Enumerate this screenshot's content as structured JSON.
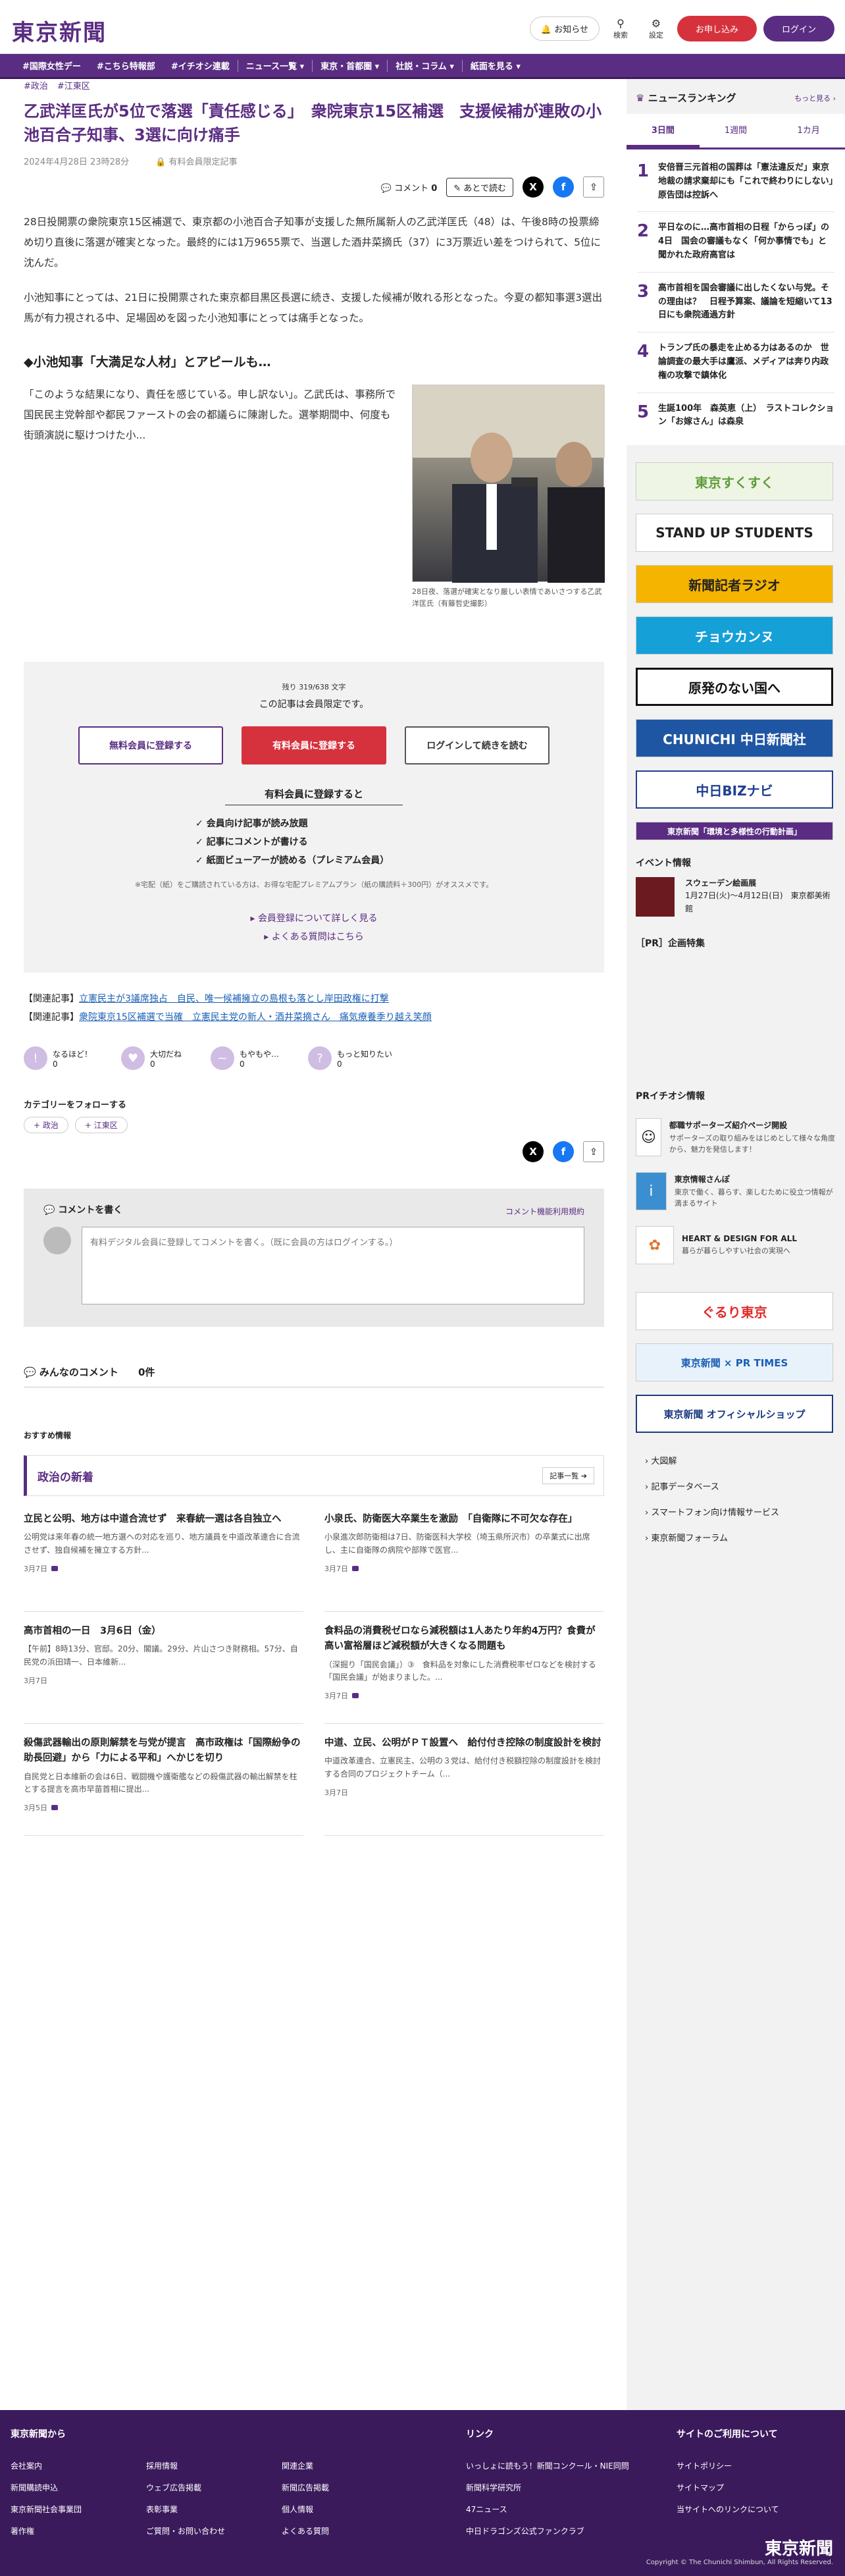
{
  "header": {
    "logo": "東京新聞",
    "notice_label": "お知らせ",
    "search_label": "検索",
    "settings_label": "設定",
    "signup_label": "お申し込み",
    "login_label": "ログイン"
  },
  "nav": [
    "#国際女性デー",
    "#こちら特報部",
    "#イチオシ連載",
    "ニュース一覧 ▾",
    "東京・首都圏 ▾",
    "社説・コラム ▾",
    "紙面を見る ▾"
  ],
  "article": {
    "tags": [
      "#政治",
      "#江東区"
    ],
    "title": "乙武洋匡氏が5位で落選「責任感じる」　衆院東京15区補選　支援候補が連敗の小池百合子知事、3選に向け痛手",
    "date": "2024年4月28日 23時28分",
    "members_only": "有料会員限定記事",
    "comment_label": "コメント",
    "comment_count": "0",
    "read_later": "あとで読む",
    "p1": "28日投開票の衆院東京15区補選で、東京都の小池百合子知事が支援した無所属新人の乙武洋匡氏（48）は、午後8時の投票締め切り直後に落選が確実となった。最終的には1万9655票で、当選した酒井菜摘氏（37）に3万票近い差をつけられて、5位に沈んだ。",
    "p2": "小池知事にとっては、21日に投開票された東京都目黒区長選に続き、支援した候補が敗れる形となった。今夏の都知事選3選出馬が有力視される中、足場固めを図った小池知事にとっては痛手となった。",
    "sub": "◆小池知事「大満足な人材」とアピールも…",
    "p3": "「このような結果になり、責任を感じている。申し訳ない」。乙武氏は、事務所で国民民主党幹部や都民ファーストの会の都議らに陳謝した。選挙期間中、何度も街頭演説に駆けつけた小...",
    "photo_caption": "28日夜、落選が確実となり厳しい表情であいさつする乙武洋匡氏（有籐哲史撮影）"
  },
  "paywall": {
    "remaining": "残り 319/638 文字",
    "limited": "この記事は会員限定です。",
    "free_btn": "無料会員に登録する",
    "paid_btn": "有料会員に登録する",
    "login_btn": "ログインして続きを読む",
    "benefits_title": "有料会員に登録すると",
    "benefits": [
      "会員向け記事が読み放題",
      "記事にコメントが書ける",
      "紙面ビューアーが読める（プレミアム会員）"
    ],
    "note": "※宅配（紙）をご購読されている方は、お得な宅配プレミアムプラン（紙の購読料＋300円）がオススメです。",
    "link1": "会員登録について詳しく見る",
    "link2": "よくある質問はこちら"
  },
  "related": [
    {
      "label": "【関連記事】",
      "text": "立憲民主が3議席独占　自民、唯一候補擁立の島根も落とし岸田政権に打撃"
    },
    {
      "label": "【関連記事】",
      "text": "衆院東京15区補選で当確　立憲民主党の新人・酒井菜摘さん　痛気療養季り越え笑顔"
    }
  ],
  "reactions": [
    {
      "label": "なるほど！",
      "count": "0",
      "icon": "!"
    },
    {
      "label": "大切だね",
      "count": "0",
      "icon": "♥"
    },
    {
      "label": "もやもや…",
      "count": "0",
      "icon": "~"
    },
    {
      "label": "もっと知りたい",
      "count": "0",
      "icon": "?"
    }
  ],
  "follow": {
    "title": "カテゴリーをフォローする",
    "chips": [
      "政治",
      "江東区"
    ]
  },
  "comment_box": {
    "title": "コメントを書く",
    "rules": "コメント機能利用規約",
    "placeholder": "有料デジタル会員に登録してコメントを書く。（既に会員の方はログインする。）"
  },
  "all_comments": {
    "title": "みんなのコメント",
    "count": "0件"
  },
  "recommend": "おすすめ情報",
  "latest": {
    "title": "政治の新着",
    "more": "記事一覧 ➔",
    "cards": [
      {
        "title": "立民と公明、地方は中道合流せず　来春統一選は各自独立へ",
        "summary": "公明党は来年春の統一地方選への対応を巡り、地方議員を中道改革連合に合流させず、独自候補を擁立する方針...",
        "date": "3月7日"
      },
      {
        "title": "小泉氏、防衛医大卒業生を激励　「自衛隊に不可欠な存在」",
        "summary": "小泉進次郎防衛相は7日、防衛医科大学校（埼玉県所沢市）の卒業式に出席し、主に自衛隊の病院や部隊で医官...",
        "date": "3月7日"
      },
      {
        "title": "高市首相の一日　3月6日（金）",
        "summary": "【午前】8時13分、官邸。20分、閣議。29分、片山さつき財務相。57分、自民党の浜田靖一、日本維新...",
        "date": "3月7日"
      },
      {
        "title": "食料品の消費税ゼロなら減税額は1人あたり年約4万円？食費が高い富裕層ほど減税額が大きくなる問題も",
        "summary": "（深掘り「国民会議」）③　食料品を対象にした消費税率ゼロなどを検討する「国民会議」が始まりました。...",
        "date": "3月7日"
      },
      {
        "title": "殺傷武器輸出の原則解禁を与党が提言　高市政権は「国際紛争の助長回避」から「力による平和」へかじを切り",
        "summary": "自民党と日本維新の会は6日、戦闘機や護衛艦などの殺傷武器の輸出解禁を柱とする提言を高市早苗首相に提出...",
        "date": "3月5日"
      },
      {
        "title": "中道、立民、公明がＰＴ設置へ　給付付き控除の制度設計を検討",
        "summary": "中道改革連合、立憲民主、公明の３党は、給付付き税額控除の制度設計を検討する合同のプロジェクトチーム（...",
        "date": "3月7日"
      }
    ]
  },
  "ranking": {
    "title": "ニュースランキング",
    "more": "もっと見る ›",
    "tabs": [
      "3日間",
      "1週間",
      "1カ月"
    ],
    "items": [
      "安倍晋三元首相の国葬は「憲法違反だ」東京地裁の請求棄却にも「これで終わりにしない」原告団は控訴へ",
      "平日なのに…高市首相の日程「からっぽ」の4日　国会の審議もなく「何か事情でも」と聞かれた政府高官は",
      "高市首相を国会審議に出したくない与党。その理由は？　日程予算案、議論を短縮いて13日にも衆院通過方針",
      "トランプ氏の暴走を止める力はあるのか　世論調査の最大手は鷹派、メディアは奔り内政権の攻撃で鎮体化",
      "生誕100年　森英恵（上）　ラストコレクション「お嫁さん」は森泉"
    ]
  },
  "banners": [
    "東京すくすく",
    "STAND UP STUDENTS",
    "新聞記者ラジオ",
    "チョウカンヌ",
    "原発のない国へ",
    "CHUNICHI 中日新聞社",
    "中日BIZナビ",
    "東京新聞「環境と多様性の行動計画」"
  ],
  "event": {
    "title": "イベント情報",
    "name": "スウェーデン絵画展",
    "desc": "1月27日(火)～4月12日(日)　東京都美術館"
  },
  "pr_feature": "［PR］企画特集",
  "pr_pick": {
    "title": "PRイチオシ情報",
    "items": [
      {
        "icon": "☺",
        "title": "都職サポーターズ紹介ページ開設",
        "desc": "サポーターズの取り組みをはじめとして様々な角度から、魅力を発信します！"
      },
      {
        "icon": "i",
        "title": "東京情報さんぽ",
        "desc": "東京で働く、暮らす、楽しむために役立つ情報が満まるサイト"
      },
      {
        "icon": "✿",
        "title": "HEART & DESIGN FOR ALL",
        "desc": "暮らが暮らしやすい社会の実現へ"
      }
    ]
  },
  "banners2": [
    "ぐるり東京",
    "東京新聞 × PR TIMES",
    "東京新聞 オフィシャルショップ"
  ],
  "side_links": [
    "大図解",
    "記事データベース",
    "スマートフォン向け情報サービス",
    "東京新聞フォーラム"
  ],
  "footer": {
    "col1_title": "東京新聞から",
    "col1": [
      "会社案内",
      "採用情報",
      "関連企業",
      "新聞購読申込",
      "ウェブ広告掲載",
      "新聞広告掲載",
      "東京新聞社会事業団",
      "表彰事業",
      "個人情報",
      "著作権",
      "ご質問・お問い合わせ",
      "よくある質問"
    ],
    "col2_title": "リンク",
    "col2": [
      "いっしょに読もう！新聞コンクール・NIE同問",
      "新聞科学研究所",
      "47ニュース",
      "中日ドラゴンズ公式ファンクラブ"
    ],
    "col3_title": "サイトのご利用について",
    "col3": [
      "サイトポリシー",
      "サイトマップ",
      "当サイトへのリンクについて"
    ],
    "logo": "東京新聞",
    "copyright": "Copyright © The Chunichi Shimbun, All Rights Reserved."
  }
}
